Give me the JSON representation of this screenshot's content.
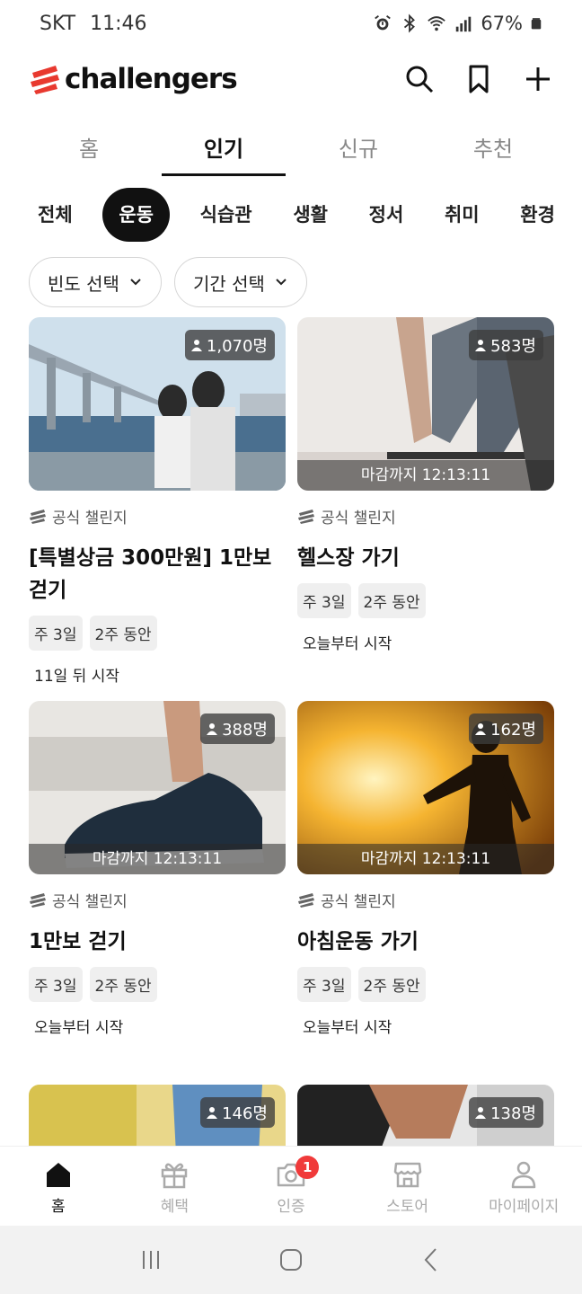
{
  "status": {
    "carrier": "SKT",
    "time": "11:46",
    "battery": "67%"
  },
  "app": {
    "brand": "challengers",
    "brand_color": "#e8392f"
  },
  "header": {
    "icons": [
      "search-icon",
      "bookmark-icon",
      "plus-icon"
    ]
  },
  "tabs": [
    {
      "label": "홈",
      "active": false
    },
    {
      "label": "인기",
      "active": true
    },
    {
      "label": "신규",
      "active": false
    },
    {
      "label": "추천",
      "active": false
    }
  ],
  "categories": [
    {
      "label": "전체",
      "active": false
    },
    {
      "label": "운동",
      "active": true
    },
    {
      "label": "식습관",
      "active": false
    },
    {
      "label": "생활",
      "active": false
    },
    {
      "label": "정서",
      "active": false
    },
    {
      "label": "취미",
      "active": false
    },
    {
      "label": "환경",
      "active": false
    }
  ],
  "filters": [
    {
      "label": "빈도 선택"
    },
    {
      "label": "기간 선택"
    }
  ],
  "cards": [
    {
      "participants": "1,070명",
      "deadline": "",
      "official": "공식 챌린지",
      "title": "[특별상금 300만원] 1만보 걷기",
      "tags": [
        "주 3일",
        "2주 동안"
      ],
      "start": "11일 뒤 시작"
    },
    {
      "participants": "583명",
      "deadline": "마감까지 12:13:11",
      "official": "공식 챌린지",
      "title": "헬스장 가기",
      "tags": [
        "주 3일",
        "2주 동안"
      ],
      "start": "오늘부터 시작"
    },
    {
      "participants": "388명",
      "deadline": "마감까지 12:13:11",
      "official": "공식 챌린지",
      "title": "1만보 걷기",
      "tags": [
        "주 3일",
        "2주 동안"
      ],
      "start": "오늘부터 시작"
    },
    {
      "participants": "162명",
      "deadline": "마감까지 12:13:11",
      "official": "공식 챌린지",
      "title": "아침운동 가기",
      "tags": [
        "주 3일",
        "2주 동안"
      ],
      "start": "오늘부터 시작"
    },
    {
      "participants": "146명",
      "deadline": "",
      "official": "",
      "title": "",
      "tags": [],
      "start": ""
    },
    {
      "participants": "138명",
      "deadline": "",
      "official": "",
      "title": "",
      "tags": [],
      "start": ""
    }
  ],
  "bottom_nav": [
    {
      "label": "홈",
      "icon": "home-icon",
      "active": true
    },
    {
      "label": "혜택",
      "icon": "gift-icon",
      "active": false
    },
    {
      "label": "인증",
      "icon": "camera-icon",
      "active": false,
      "badge": "1"
    },
    {
      "label": "스토어",
      "icon": "store-icon",
      "active": false
    },
    {
      "label": "마이페이지",
      "icon": "person-icon",
      "active": false
    }
  ]
}
